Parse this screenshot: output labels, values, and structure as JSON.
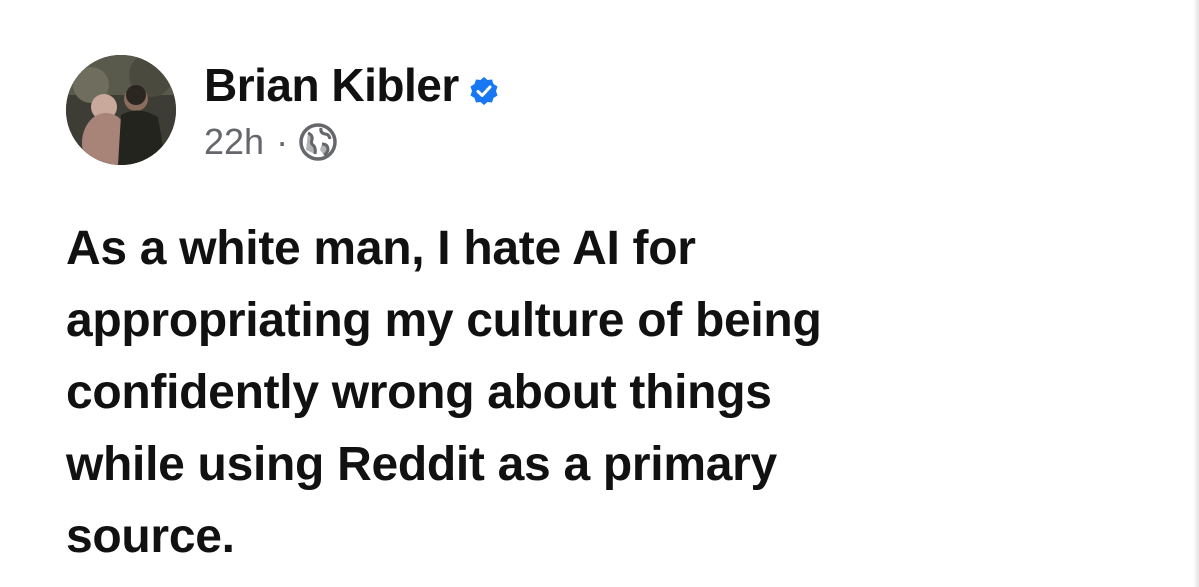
{
  "post": {
    "author": {
      "name": "Brian Kibler",
      "verified": true,
      "avatar_icon": "profile-photo"
    },
    "timestamp": "22h",
    "separator": "·",
    "audience_icon": "globe-icon",
    "body_lines": [
      "As a white man, I hate AI for",
      "appropriating my culture of being",
      "confidently wrong about things",
      "while using Reddit as a primary",
      "source."
    ]
  },
  "colors": {
    "verified_badge": "#1877f2",
    "meta_text": "#65676b",
    "body_text": "#111111"
  }
}
